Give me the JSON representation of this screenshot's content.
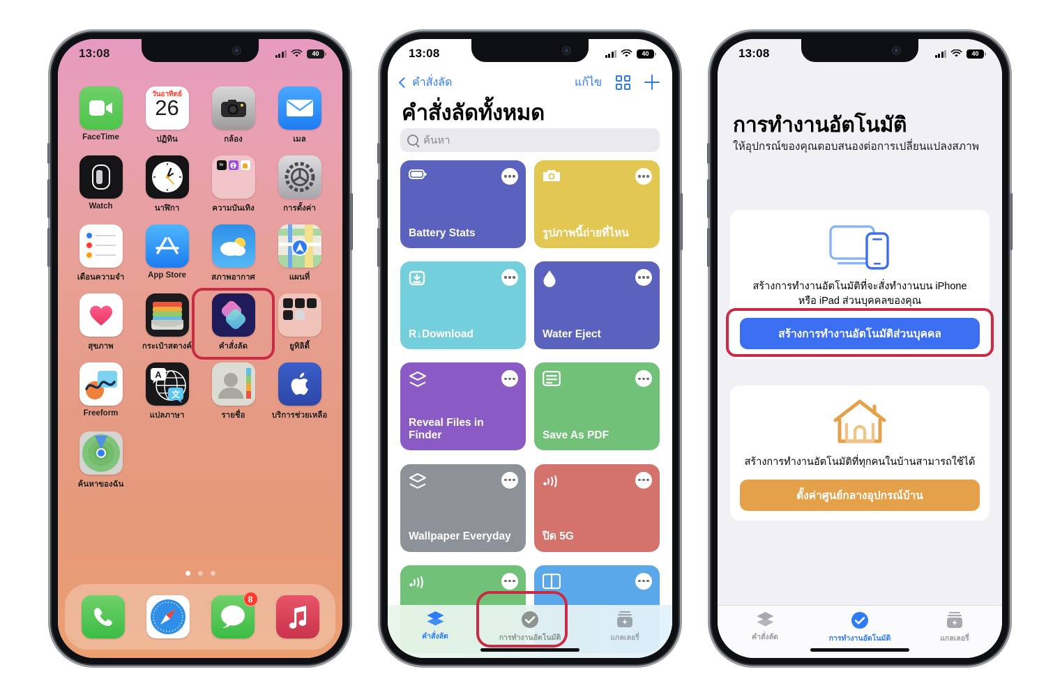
{
  "status_bar": {
    "time": "13:08",
    "battery_level": "40",
    "wifi_icon": "wifi-icon",
    "cellular_icon": "cellular-signal-icon",
    "battery_icon": "battery-icon"
  },
  "colors": {
    "highlight_red": "#c92a44",
    "ios_blue": "#2f7bf6",
    "cta_blue": "#3b6ef0",
    "cta_orange": "#e5a04a",
    "tab_inactive": "#9a9aa0"
  },
  "phone1": {
    "name": "home-screen",
    "wallpaper": "pink-orange-gradient",
    "calendar_widget": {
      "weekday": "วันอาทิตย์",
      "day": "26"
    },
    "rows": [
      [
        {
          "label": "FaceTime",
          "icon": "facetime-icon"
        },
        {
          "label": "ปฏิทิน",
          "icon": "calendar-icon"
        },
        {
          "label": "กล้อง",
          "icon": "camera-icon"
        },
        {
          "label": "เมล",
          "icon": "mail-icon"
        }
      ],
      [
        {
          "label": "Watch",
          "icon": "watch-icon"
        },
        {
          "label": "นาฬิกา",
          "icon": "clock-icon"
        },
        {
          "label": "ความบันเทิง",
          "icon": "folder-entertainment-icon"
        },
        {
          "label": "การตั้งค่า",
          "icon": "settings-icon"
        }
      ],
      [
        {
          "label": "เตือนความจำ",
          "icon": "reminders-icon"
        },
        {
          "label": "App Store",
          "icon": "appstore-icon"
        },
        {
          "label": "สภาพอากาศ",
          "icon": "weather-icon"
        },
        {
          "label": "แผนที่",
          "icon": "maps-icon"
        }
      ],
      [
        {
          "label": "สุขภาพ",
          "icon": "health-icon"
        },
        {
          "label": "กระเป๋าสตางค์",
          "icon": "wallet-icon"
        },
        {
          "label": "คำสั่งลัด",
          "icon": "shortcuts-icon"
        },
        {
          "label": "ยูทิลิตี้",
          "icon": "folder-utilities-icon"
        }
      ],
      [
        {
          "label": "Freeform",
          "icon": "freeform-icon"
        },
        {
          "label": "แปลภาษา",
          "icon": "translate-icon"
        },
        {
          "label": "รายชื่อ",
          "icon": "contacts-icon"
        },
        {
          "label": "บริการช่วยเหลือ",
          "icon": "support-icon"
        }
      ],
      [
        {
          "label": "ค้นหาของฉัน",
          "icon": "findmy-icon"
        }
      ]
    ],
    "page_dots": {
      "count": 3,
      "active_index": 0
    },
    "dock": [
      {
        "label": "Phone",
        "icon": "phone-icon",
        "badge": ""
      },
      {
        "label": "Safari",
        "icon": "safari-icon",
        "badge": ""
      },
      {
        "label": "Messages",
        "icon": "messages-icon",
        "badge": "8"
      },
      {
        "label": "Music",
        "icon": "music-icon",
        "badge": ""
      }
    ],
    "highlight_target": "คำสั่งลัด"
  },
  "phone2": {
    "name": "shortcuts-all-shortcuts",
    "nav": {
      "back_label": "คำสั่งลัด",
      "edit_label": "แก้ไข",
      "grid_icon": "grid-view-icon",
      "add_icon": "plus-icon"
    },
    "title": "คำสั่งลัดทั้งหมด",
    "search_placeholder": "ค้นหา",
    "shortcuts": [
      {
        "name": "Battery Stats",
        "color": "#5b62bd",
        "icon": "battery-full-icon"
      },
      {
        "name": "รูปภาพนี้ถ่ายที่ไหน",
        "color": "#e2c753",
        "icon": "camera-glyph-icon"
      },
      {
        "name": "R↓Download",
        "color": "#74cfdc",
        "icon": "download-tray-icon"
      },
      {
        "name": "Water Eject",
        "color": "#5b62bd",
        "icon": "water-drop-icon"
      },
      {
        "name": "Reveal Files in Finder",
        "color": "#8a5bc4",
        "icon": "layers-icon"
      },
      {
        "name": "Save As PDF",
        "color": "#71c178",
        "icon": "document-icon"
      },
      {
        "name": "Wallpaper Everyday",
        "color": "#8d9298",
        "icon": "layers-icon"
      },
      {
        "name": "ปิด 5G",
        "color": "#d4726c",
        "icon": "broadcast-icon"
      },
      {
        "name": "",
        "color": "#71c178",
        "icon": "broadcast-icon"
      },
      {
        "name": "",
        "color": "#5aa8ea",
        "icon": "grid-glyph-icon"
      }
    ],
    "tabs": [
      {
        "label": "คำสั่งลัด",
        "icon": "shortcuts-tab-icon",
        "active": true
      },
      {
        "label": "การทำงานอัตโนมัติ",
        "icon": "automation-tab-icon",
        "active": false
      },
      {
        "label": "แกลเลอรี่",
        "icon": "gallery-tab-icon",
        "active": false
      }
    ],
    "highlight_target": "การทำงานอัตโนมัติ"
  },
  "phone3": {
    "name": "automation-tab",
    "title": "การทำงานอัตโนมัติ",
    "subtitle": "ให้อุปกรณ์ของคุณตอบสนองต่อการเปลี่ยนแปลงสภาพ",
    "panels": [
      {
        "icon": "devices-ipad-iphone-icon",
        "text": "สร้างการทำงานอัตโนมัติที่จะสั่งทำงานบน iPhone หรือ iPad ส่วนบุคคลของคุณ",
        "button_label": "สร้างการทำงานอัตโนมัติส่วนบุคคล",
        "button_color": "#3b6ef0",
        "highlighted": true
      },
      {
        "icon": "home-house-icon",
        "text": "สร้างการทำงานอัตโนมัติที่ทุกคนในบ้านสามารถใช้ได้",
        "button_label": "ตั้งค่าศูนย์กลางอุปกรณ์บ้าน",
        "button_color": "#e5a04a",
        "highlighted": false
      }
    ],
    "tabs": [
      {
        "label": "คำสั่งลัด",
        "icon": "shortcuts-tab-icon",
        "active": false
      },
      {
        "label": "การทำงานอัตโนมัติ",
        "icon": "automation-tab-icon",
        "active": true
      },
      {
        "label": "แกลเลอรี่",
        "icon": "gallery-tab-icon",
        "active": false
      }
    ]
  }
}
